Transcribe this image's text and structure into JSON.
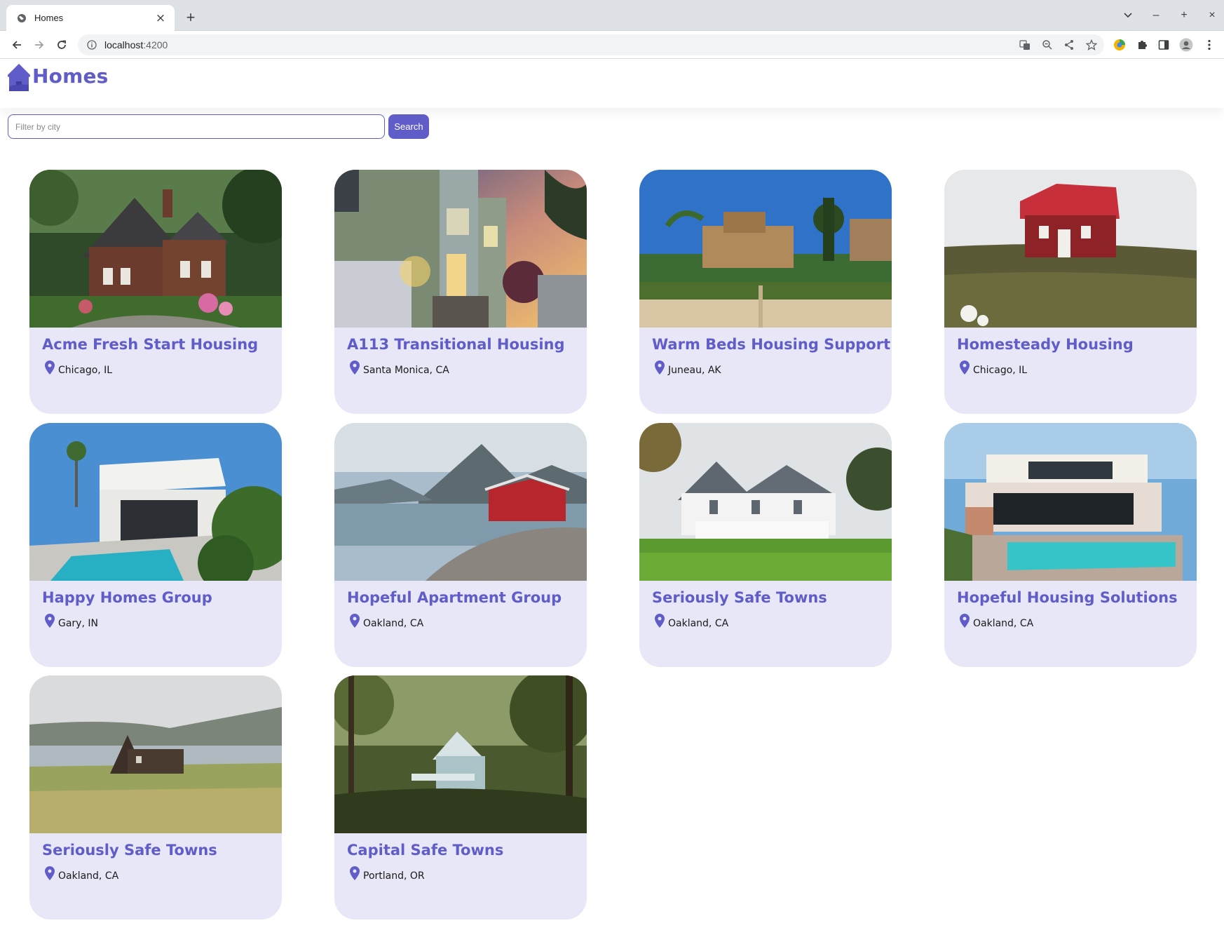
{
  "browser": {
    "tab_title": "Homes",
    "url_host": "localhost",
    "url_port": ":4200"
  },
  "header": {
    "brand_title": "Homes"
  },
  "search": {
    "placeholder": "Filter by city",
    "button_label": "Search"
  },
  "colors": {
    "accent": "#605dc8",
    "card_background": "#e8e7f7"
  },
  "listings": [
    {
      "name": "Acme Fresh Start Housing",
      "city": "Chicago, IL",
      "photo": "brick-cottage-garden"
    },
    {
      "name": "A113 Transitional Housing",
      "city": "Santa Monica, CA",
      "photo": "modern-house-sunset"
    },
    {
      "name": "Warm Beds Housing Support",
      "city": "Juneau, AK",
      "photo": "palace-reflecting-pool"
    },
    {
      "name": "Homesteady Housing",
      "city": "Chicago, IL",
      "photo": "red-cabin-hill"
    },
    {
      "name": "Happy Homes Group",
      "city": "Gary, IN",
      "photo": "white-modern-villa-pool"
    },
    {
      "name": "Hopeful Apartment Group",
      "city": "Oakland, CA",
      "photo": "red-house-fjord"
    },
    {
      "name": "Seriously Safe Towns",
      "city": "Oakland, CA",
      "photo": "white-farmhouse-porch"
    },
    {
      "name": "Hopeful Housing Solutions",
      "city": "Oakland, CA",
      "photo": "modern-villa-pool"
    },
    {
      "name": "Seriously Safe Towns",
      "city": "Oakland, CA",
      "photo": "a-frame-lakeside"
    },
    {
      "name": "Capital Safe Towns",
      "city": "Portland, OR",
      "photo": "forest-cabin"
    }
  ]
}
